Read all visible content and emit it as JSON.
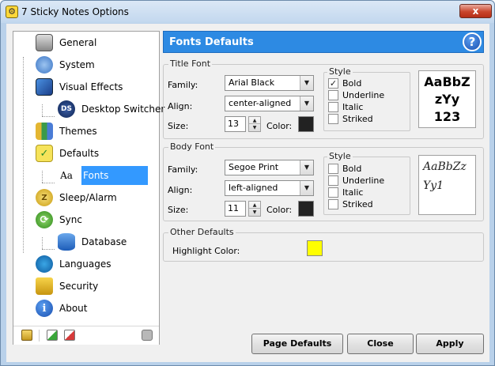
{
  "window": {
    "title": "7 Sticky Notes Options",
    "close_glyph": "x"
  },
  "nav": {
    "items": [
      {
        "label": "General"
      },
      {
        "label": "System"
      },
      {
        "label": "Visual Effects"
      },
      {
        "label": "Desktop Switcher"
      },
      {
        "label": "Themes"
      },
      {
        "label": "Defaults"
      },
      {
        "label": "Fonts"
      },
      {
        "label": "Sleep/Alarm"
      },
      {
        "label": "Sync"
      },
      {
        "label": "Database"
      },
      {
        "label": "Languages"
      },
      {
        "label": "Security"
      },
      {
        "label": "About"
      }
    ],
    "selected": "Fonts",
    "font_icon_text": "Aa",
    "ds_icon_text": "DS"
  },
  "header": {
    "title": "Fonts Defaults",
    "help_glyph": "?"
  },
  "title_font": {
    "legend": "Title Font",
    "family_label": "Family:",
    "family_value": "Arial Black",
    "align_label": "Align:",
    "align_value": "center-aligned",
    "size_label": "Size:",
    "size_value": "13",
    "color_label": "Color:",
    "color_value": "#222222",
    "style_legend": "Style",
    "styles": [
      {
        "label": "Bold",
        "checked": true
      },
      {
        "label": "Underline",
        "checked": false
      },
      {
        "label": "Italic",
        "checked": false
      },
      {
        "label": "Striked",
        "checked": false
      }
    ],
    "preview_lines": [
      "AaBbZ",
      "zYy",
      "123"
    ]
  },
  "body_font": {
    "legend": "Body Font",
    "family_label": "Family:",
    "family_value": "Segoe Print",
    "align_label": "Align:",
    "align_value": "left-aligned",
    "size_label": "Size:",
    "size_value": "11",
    "color_label": "Color:",
    "color_value": "#222222",
    "style_legend": "Style",
    "styles": [
      {
        "label": "Bold",
        "checked": false
      },
      {
        "label": "Underline",
        "checked": false
      },
      {
        "label": "Italic",
        "checked": false
      },
      {
        "label": "Striked",
        "checked": false
      }
    ],
    "preview_lines": [
      "AaBbZz",
      "Yy1"
    ]
  },
  "other": {
    "legend": "Other Defaults",
    "highlight_label": "Highlight Color:",
    "highlight_color": "#ffff00"
  },
  "buttons": {
    "page_defaults": "Page Defaults",
    "close": "Close",
    "apply": "Apply"
  },
  "glyphs": {
    "check": "✓",
    "arrow_down": "▼",
    "arrow_up": "▲"
  }
}
